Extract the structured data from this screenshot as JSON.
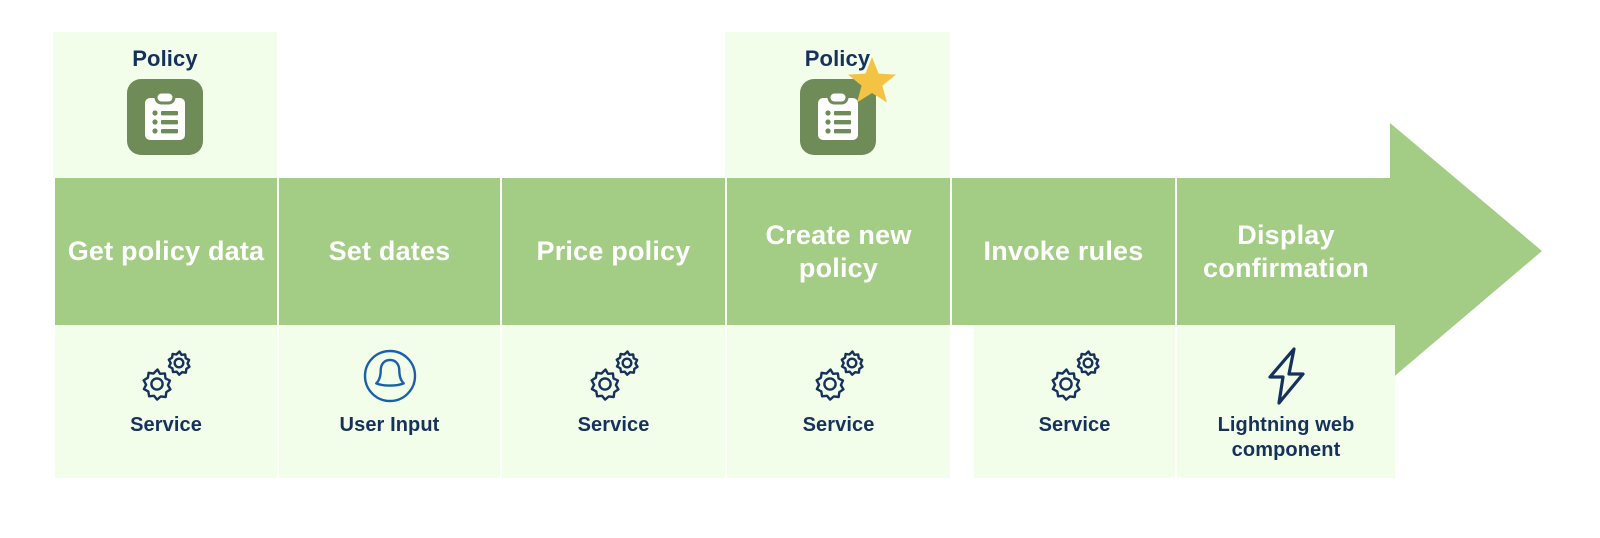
{
  "diagram": {
    "title_colors": {
      "band_green": "#a3cd85",
      "pale_green": "#f2fdea",
      "icon_tile_green": "#6f8b58",
      "navy_text": "#16325c",
      "star_gold": "#f5c344",
      "white": "#ffffff"
    },
    "steps": [
      {
        "id": "get-policy-data",
        "top_caption": "Policy",
        "top_icon": "clipboard-policy-icon",
        "top_badge": null,
        "band_label": "Get policy data",
        "bottom_icon": "gears-service-icon",
        "bottom_caption": "Service"
      },
      {
        "id": "set-dates",
        "top_caption": null,
        "top_icon": null,
        "top_badge": null,
        "band_label": "Set dates",
        "bottom_icon": "user-input-icon",
        "bottom_caption": "User Input"
      },
      {
        "id": "price-policy",
        "top_caption": null,
        "top_icon": null,
        "top_badge": null,
        "band_label": "Price policy",
        "bottom_icon": "gears-service-icon",
        "bottom_caption": "Service"
      },
      {
        "id": "create-new-policy",
        "top_caption": "Policy",
        "top_icon": "clipboard-policy-icon",
        "top_badge": "star-new-badge-icon",
        "band_label": "Create new policy",
        "bottom_icon": "gears-service-icon",
        "bottom_caption": "Service"
      },
      {
        "id": "invoke-rules",
        "top_caption": null,
        "top_icon": null,
        "top_badge": null,
        "band_label": "Invoke rules",
        "bottom_icon": "gears-service-icon",
        "bottom_caption": "Service"
      },
      {
        "id": "display-confirmation",
        "top_caption": null,
        "top_icon": null,
        "top_badge": null,
        "band_label": "Display confirmation",
        "bottom_icon": "lightning-bolt-icon",
        "bottom_caption": "Lightning web component"
      }
    ],
    "flow_arrow": {
      "icon": "right-arrow-head",
      "direction": "right"
    }
  }
}
